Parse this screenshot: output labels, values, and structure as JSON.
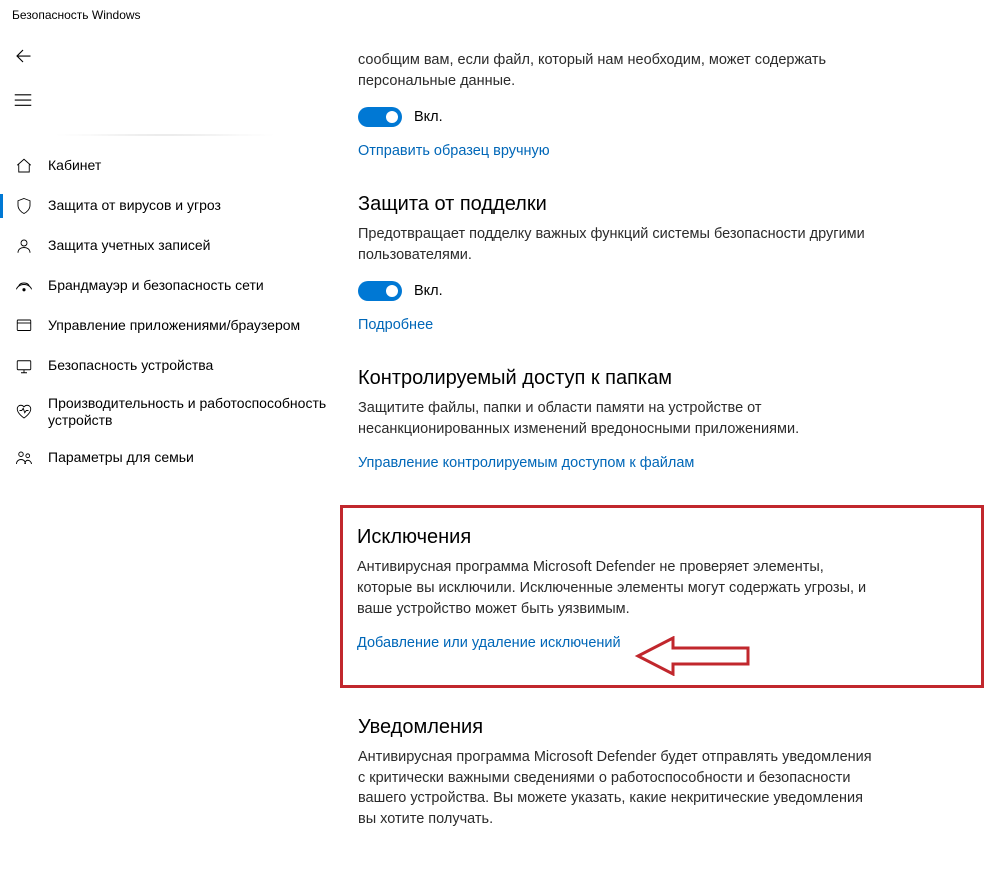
{
  "window": {
    "title": "Безопасность Windows"
  },
  "sidebar": {
    "items": [
      {
        "label": "Кабинет",
        "icon": "home"
      },
      {
        "label": "Защита от вирусов и угроз",
        "icon": "shield",
        "active": true
      },
      {
        "label": "Защита учетных записей",
        "icon": "account"
      },
      {
        "label": "Брандмауэр и безопасность сети",
        "icon": "network"
      },
      {
        "label": "Управление приложениями/браузером",
        "icon": "app"
      },
      {
        "label": "Безопасность устройства",
        "icon": "device"
      },
      {
        "label": "Производительность и работоспособность устройств",
        "icon": "heart"
      },
      {
        "label": "Параметры для семьи",
        "icon": "family"
      }
    ]
  },
  "content": {
    "sample_submission": {
      "desc_fragment": "сообщим вам, если файл, который нам необходим, может содержать персональные данные.",
      "toggle_state": "Вкл.",
      "link": "Отправить образец вручную"
    },
    "tamper": {
      "heading": "Защита от подделки",
      "desc": "Предотвращает подделку важных функций системы безопасности другими пользователями.",
      "toggle_state": "Вкл.",
      "link": "Подробнее"
    },
    "controlled_access": {
      "heading": "Контролируемый доступ к папкам",
      "desc": "Защитите файлы, папки и области памяти на устройстве от несанкционированных изменений вредоносными приложениями.",
      "link": "Управление контролируемым доступом к файлам"
    },
    "exclusions": {
      "heading": "Исключения",
      "desc": "Антивирусная программа Microsoft Defender не проверяет элементы, которые вы исключили. Исключенные элементы могут содержать угрозы, и ваше устройство может быть уязвимым.",
      "link": "Добавление или удаление исключений"
    },
    "notifications": {
      "heading": "Уведомления",
      "desc": "Антивирусная программа Microsoft Defender будет отправлять уведомления с критически важными сведениями о работоспособности и безопасности вашего устройства. Вы можете указать, какие некритические уведомления вы хотите получать."
    }
  }
}
